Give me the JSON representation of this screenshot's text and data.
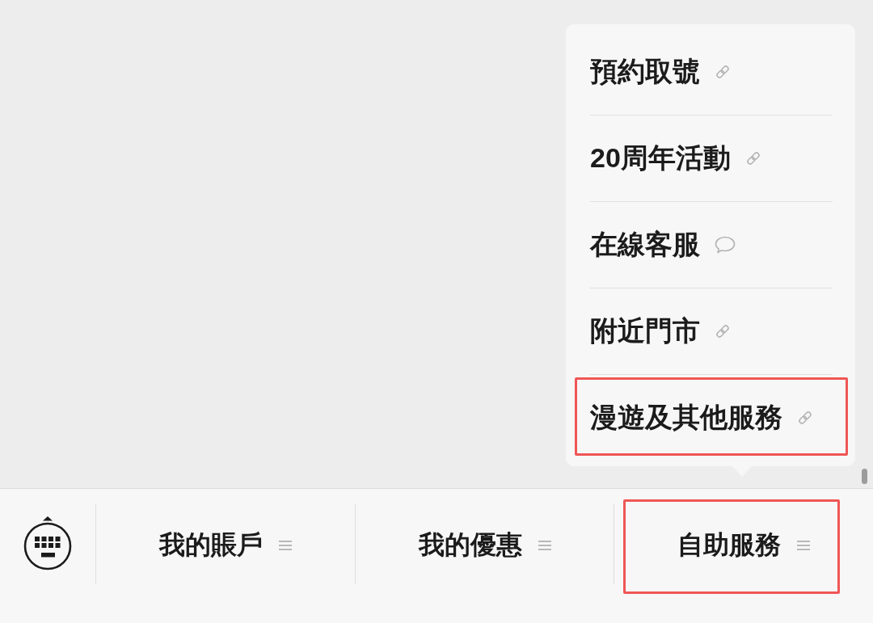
{
  "menu": {
    "items": [
      {
        "label": "預約取號",
        "kind": "link",
        "highlighted": false
      },
      {
        "label": "20周年活動",
        "kind": "link",
        "highlighted": false
      },
      {
        "label": "在線客服",
        "kind": "chat",
        "highlighted": false
      },
      {
        "label": "附近門市",
        "kind": "link",
        "highlighted": false
      },
      {
        "label": "漫遊及其他服務",
        "kind": "link",
        "highlighted": true
      }
    ]
  },
  "bottom_bar": {
    "tabs": [
      {
        "label": "我的賬戶",
        "highlighted": false
      },
      {
        "label": "我的優惠",
        "highlighted": false
      },
      {
        "label": "自助服務",
        "highlighted": true
      }
    ]
  }
}
